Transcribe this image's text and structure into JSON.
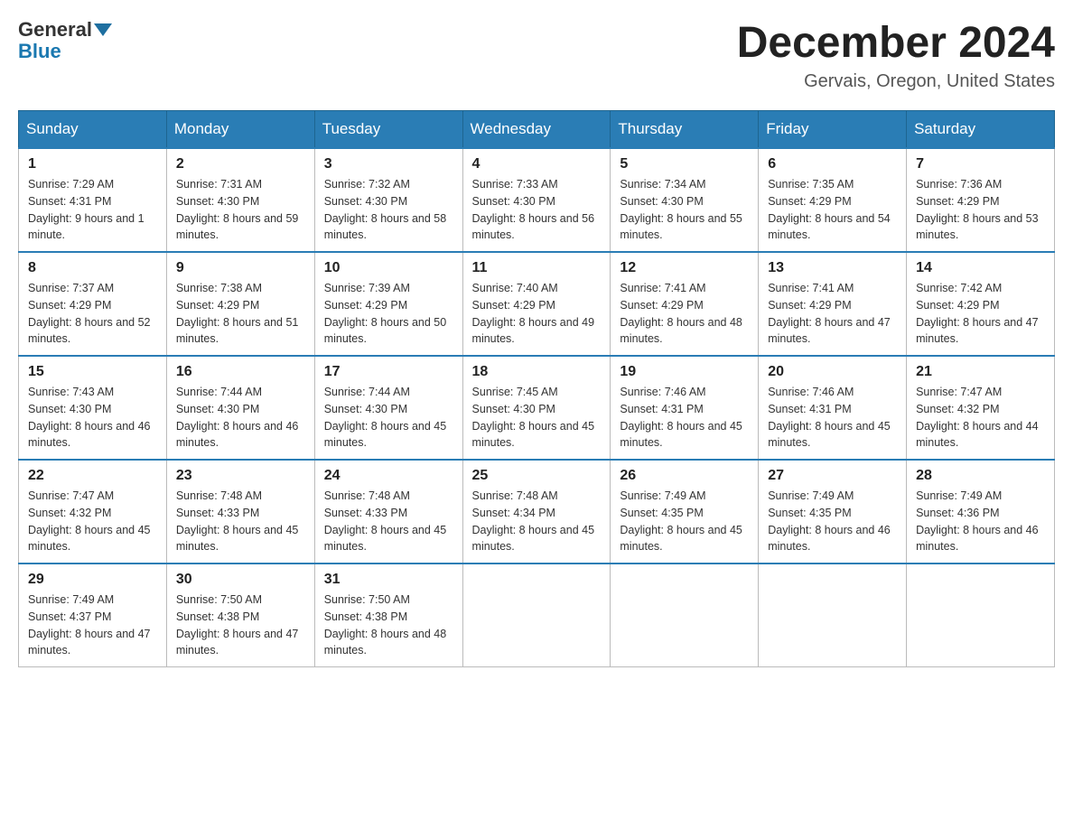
{
  "header": {
    "logo_general": "General",
    "logo_blue": "Blue",
    "month_year": "December 2024",
    "location": "Gervais, Oregon, United States"
  },
  "days_of_week": [
    "Sunday",
    "Monday",
    "Tuesday",
    "Wednesday",
    "Thursday",
    "Friday",
    "Saturday"
  ],
  "weeks": [
    [
      {
        "day": 1,
        "sunrise": "7:29 AM",
        "sunset": "4:31 PM",
        "daylight": "9 hours and 1 minute."
      },
      {
        "day": 2,
        "sunrise": "7:31 AM",
        "sunset": "4:30 PM",
        "daylight": "8 hours and 59 minutes."
      },
      {
        "day": 3,
        "sunrise": "7:32 AM",
        "sunset": "4:30 PM",
        "daylight": "8 hours and 58 minutes."
      },
      {
        "day": 4,
        "sunrise": "7:33 AM",
        "sunset": "4:30 PM",
        "daylight": "8 hours and 56 minutes."
      },
      {
        "day": 5,
        "sunrise": "7:34 AM",
        "sunset": "4:30 PM",
        "daylight": "8 hours and 55 minutes."
      },
      {
        "day": 6,
        "sunrise": "7:35 AM",
        "sunset": "4:29 PM",
        "daylight": "8 hours and 54 minutes."
      },
      {
        "day": 7,
        "sunrise": "7:36 AM",
        "sunset": "4:29 PM",
        "daylight": "8 hours and 53 minutes."
      }
    ],
    [
      {
        "day": 8,
        "sunrise": "7:37 AM",
        "sunset": "4:29 PM",
        "daylight": "8 hours and 52 minutes."
      },
      {
        "day": 9,
        "sunrise": "7:38 AM",
        "sunset": "4:29 PM",
        "daylight": "8 hours and 51 minutes."
      },
      {
        "day": 10,
        "sunrise": "7:39 AM",
        "sunset": "4:29 PM",
        "daylight": "8 hours and 50 minutes."
      },
      {
        "day": 11,
        "sunrise": "7:40 AM",
        "sunset": "4:29 PM",
        "daylight": "8 hours and 49 minutes."
      },
      {
        "day": 12,
        "sunrise": "7:41 AM",
        "sunset": "4:29 PM",
        "daylight": "8 hours and 48 minutes."
      },
      {
        "day": 13,
        "sunrise": "7:41 AM",
        "sunset": "4:29 PM",
        "daylight": "8 hours and 47 minutes."
      },
      {
        "day": 14,
        "sunrise": "7:42 AM",
        "sunset": "4:29 PM",
        "daylight": "8 hours and 47 minutes."
      }
    ],
    [
      {
        "day": 15,
        "sunrise": "7:43 AM",
        "sunset": "4:30 PM",
        "daylight": "8 hours and 46 minutes."
      },
      {
        "day": 16,
        "sunrise": "7:44 AM",
        "sunset": "4:30 PM",
        "daylight": "8 hours and 46 minutes."
      },
      {
        "day": 17,
        "sunrise": "7:44 AM",
        "sunset": "4:30 PM",
        "daylight": "8 hours and 45 minutes."
      },
      {
        "day": 18,
        "sunrise": "7:45 AM",
        "sunset": "4:30 PM",
        "daylight": "8 hours and 45 minutes."
      },
      {
        "day": 19,
        "sunrise": "7:46 AM",
        "sunset": "4:31 PM",
        "daylight": "8 hours and 45 minutes."
      },
      {
        "day": 20,
        "sunrise": "7:46 AM",
        "sunset": "4:31 PM",
        "daylight": "8 hours and 45 minutes."
      },
      {
        "day": 21,
        "sunrise": "7:47 AM",
        "sunset": "4:32 PM",
        "daylight": "8 hours and 44 minutes."
      }
    ],
    [
      {
        "day": 22,
        "sunrise": "7:47 AM",
        "sunset": "4:32 PM",
        "daylight": "8 hours and 45 minutes."
      },
      {
        "day": 23,
        "sunrise": "7:48 AM",
        "sunset": "4:33 PM",
        "daylight": "8 hours and 45 minutes."
      },
      {
        "day": 24,
        "sunrise": "7:48 AM",
        "sunset": "4:33 PM",
        "daylight": "8 hours and 45 minutes."
      },
      {
        "day": 25,
        "sunrise": "7:48 AM",
        "sunset": "4:34 PM",
        "daylight": "8 hours and 45 minutes."
      },
      {
        "day": 26,
        "sunrise": "7:49 AM",
        "sunset": "4:35 PM",
        "daylight": "8 hours and 45 minutes."
      },
      {
        "day": 27,
        "sunrise": "7:49 AM",
        "sunset": "4:35 PM",
        "daylight": "8 hours and 46 minutes."
      },
      {
        "day": 28,
        "sunrise": "7:49 AM",
        "sunset": "4:36 PM",
        "daylight": "8 hours and 46 minutes."
      }
    ],
    [
      {
        "day": 29,
        "sunrise": "7:49 AM",
        "sunset": "4:37 PM",
        "daylight": "8 hours and 47 minutes."
      },
      {
        "day": 30,
        "sunrise": "7:50 AM",
        "sunset": "4:38 PM",
        "daylight": "8 hours and 47 minutes."
      },
      {
        "day": 31,
        "sunrise": "7:50 AM",
        "sunset": "4:38 PM",
        "daylight": "8 hours and 48 minutes."
      },
      null,
      null,
      null,
      null
    ]
  ],
  "labels": {
    "sunrise": "Sunrise:",
    "sunset": "Sunset:",
    "daylight": "Daylight:"
  }
}
